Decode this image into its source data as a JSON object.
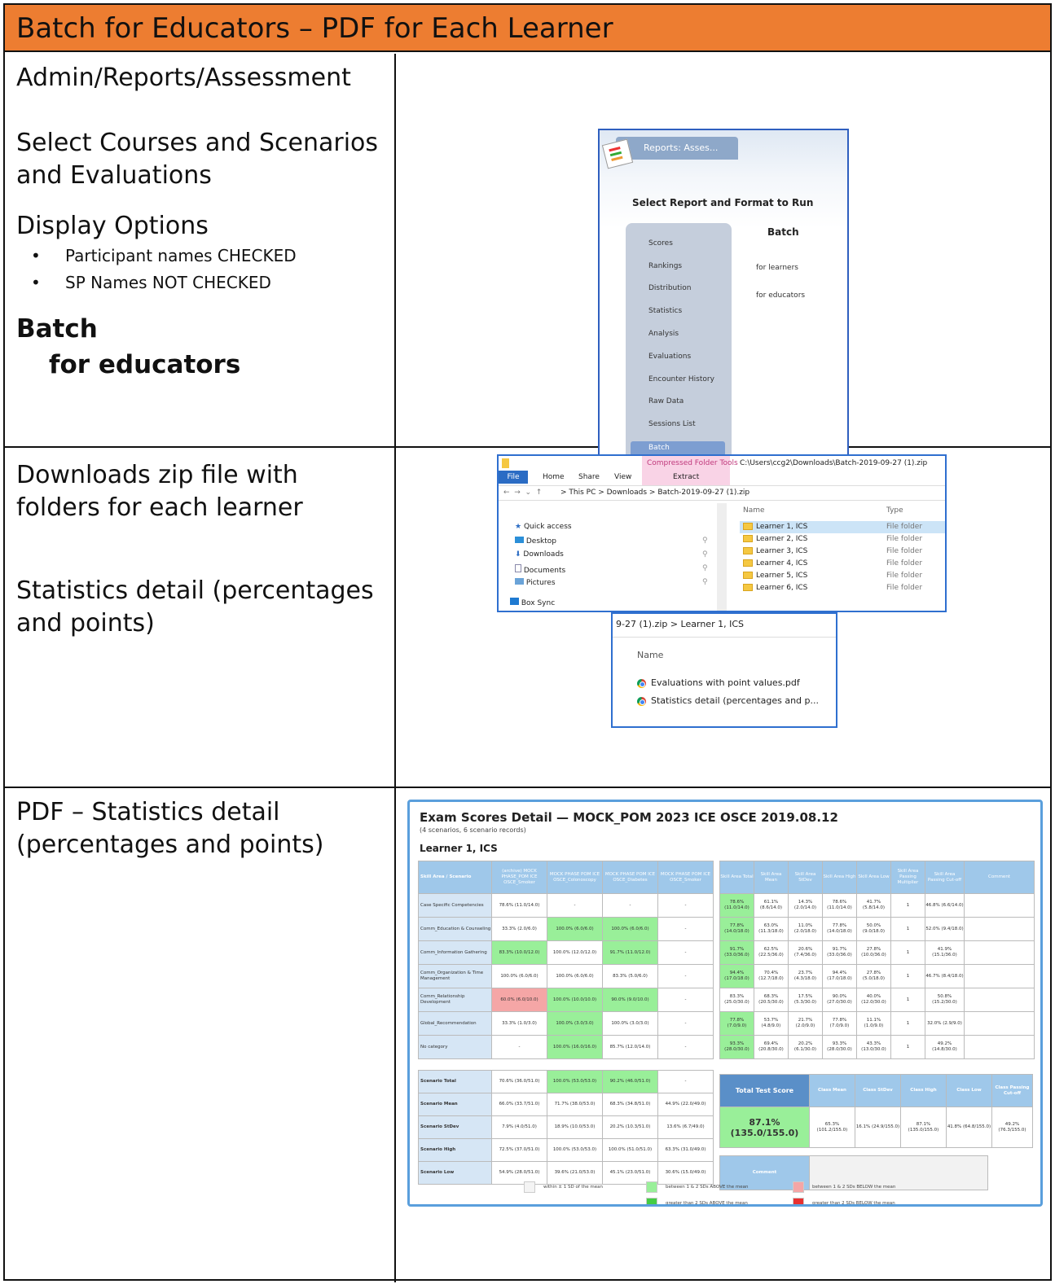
{
  "header": {
    "title": "Batch for Educators – PDF for Each Learner"
  },
  "row1": {
    "path": "Admin/Reports/Assessment",
    "select": "Select Courses and Scenarios and Evaluations",
    "display_options": "Display Options",
    "bullets": [
      "Participant names CHECKED",
      "SP Names NOT CHECKED"
    ],
    "batch": "Batch",
    "for_educators": "for educators",
    "app": {
      "tab": "Reports:  Asses...",
      "heading": "Select Report and Format to Run",
      "nav": [
        "Scores",
        "Rankings",
        "Distribution",
        "Statistics",
        "Analysis",
        "Evaluations",
        "Encounter History",
        "Raw Data",
        "Sessions List",
        "Batch"
      ],
      "batch_title": "Batch",
      "batch_options": [
        "for learners",
        "for educators"
      ]
    }
  },
  "row2": {
    "text1": "Downloads zip file with folders for each learner",
    "text2": "Statistics detail (percentages and points)",
    "explorer": {
      "ribbon_tools": "Compressed Folder Tools",
      "path_title": "C:\\Users\\ccg2\\Downloads\\Batch-2019-09-27 (1).zip",
      "tabs": [
        "File",
        "Home",
        "Share",
        "View"
      ],
      "extract": "Extract",
      "address": "> This PC > Downloads > Batch-2019-09-27 (1).zip",
      "nav": [
        "Quick access",
        "Desktop",
        "Downloads",
        "Documents",
        "Pictures",
        "Box Sync"
      ],
      "col_name": "Name",
      "col_type": "Type",
      "files": [
        {
          "name": "Learner 1, ICS",
          "type": "File folder"
        },
        {
          "name": "Learner 2, ICS",
          "type": "File folder"
        },
        {
          "name": "Learner 3, ICS",
          "type": "File folder"
        },
        {
          "name": "Learner 4, ICS",
          "type": "File folder"
        },
        {
          "name": "Learner 5, ICS",
          "type": "File folder"
        },
        {
          "name": "Learner 6, ICS",
          "type": "File folder"
        }
      ]
    },
    "explorer2": {
      "address": "9-27 (1).zip  >  Learner 1, ICS",
      "col_name": "Name",
      "files": [
        "Evaluations with point values.pdf",
        "Statistics detail (percentages and p..."
      ]
    }
  },
  "row3": {
    "text": "PDF – Statistics detail (percentages and points)",
    "report": {
      "title": "Exam Scores Detail — MOCK_POM 2023 ICE OSCE 2019.08.12",
      "subtitle": "(4 scenarios, 6 scenario records)",
      "learner": "Learner 1, ICS",
      "left_headers": [
        "Skill Area / Scenario",
        "(archive) MOCK PHASE_POM ICE OSCE_Smoker",
        "MOCK PHASE POM ICE OSCE_Colonoscopy",
        "MOCK PHASE POM ICE OSCE_Diabetes",
        "MOCK PHASE POM ICE OSCE_Smoker"
      ],
      "right_headers": [
        "Skill Area Total",
        "Skill Area Mean",
        "Skill Area StDev",
        "Skill Area High",
        "Skill Area Low",
        "Skill Area Passing Multiplier",
        "Skill Area Passing Cut-off",
        "Comment"
      ],
      "skill_rows": [
        {
          "label": "Case Specific Competencies",
          "cells": [
            "78.6% (11.0/14.0)",
            "-",
            "-",
            "-"
          ],
          "right": [
            "78.6% (11.0/14.0)",
            "61.1% (8.6/14.0)",
            "14.3% (2.0/14.0)",
            "78.6% (11.0/14.0)",
            "41.7% (5.8/14.0)",
            "1",
            "46.8% (6.6/14.0)",
            ""
          ]
        },
        {
          "label": "Comm_Education & Counseling",
          "cells": [
            "33.3% (2.0/6.0)",
            "100.0% (6.0/6.0)",
            "100.0% (6.0/6.0)",
            "-"
          ],
          "right": [
            "77.8% (14.0/18.0)",
            "63.0% (11.3/18.0)",
            "11.0% (2.0/18.0)",
            "77.8% (14.0/18.0)",
            "50.0% (9.0/18.0)",
            "1",
            "52.0% (9.4/18.0)",
            ""
          ]
        },
        {
          "label": "Comm_Information Gathering",
          "cells": [
            "83.3% (10.0/12.0)",
            "100.0% (12.0/12.0)",
            "91.7% (11.0/12.0)",
            "-"
          ],
          "right": [
            "91.7% (33.0/36.0)",
            "62.5% (22.5/36.0)",
            "20.6% (7.4/36.0)",
            "91.7% (33.0/36.0)",
            "27.8% (10.0/36.0)",
            "1",
            "41.9% (15.1/36.0)",
            ""
          ]
        },
        {
          "label": "Comm_Organization & Time Management",
          "cells": [
            "100.0% (6.0/6.0)",
            "100.0% (6.0/6.0)",
            "83.3% (5.0/6.0)",
            "-"
          ],
          "right": [
            "94.4% (17.0/18.0)",
            "70.4% (12.7/18.0)",
            "23.7% (4.3/18.0)",
            "94.4% (17.0/18.0)",
            "27.8% (5.0/18.0)",
            "1",
            "46.7% (8.4/18.0)",
            ""
          ]
        },
        {
          "label": "Comm_Relationship Development",
          "cells": [
            "60.0% (6.0/10.0)",
            "100.0% (10.0/10.0)",
            "90.0% (9.0/10.0)",
            "-"
          ],
          "right": [
            "83.3% (25.0/30.0)",
            "68.3% (20.5/30.0)",
            "17.5% (5.3/30.0)",
            "90.0% (27.0/30.0)",
            "40.0% (12.0/30.0)",
            "1",
            "50.8% (15.2/30.0)",
            ""
          ]
        },
        {
          "label": "Global_Recommendation",
          "cells": [
            "33.3% (1.0/3.0)",
            "100.0% (3.0/3.0)",
            "100.0% (3.0/3.0)",
            "-"
          ],
          "right": [
            "77.8% (7.0/9.0)",
            "53.7% (4.8/9.0)",
            "21.7% (2.0/9.0)",
            "77.8% (7.0/9.0)",
            "11.1% (1.0/9.0)",
            "1",
            "32.0% (2.9/9.0)",
            ""
          ]
        },
        {
          "label": "No category",
          "cells": [
            "-",
            "100.0% (16.0/16.0)",
            "85.7% (12.0/14.0)",
            "-"
          ],
          "right": [
            "93.3% (28.0/30.0)",
            "69.4% (20.8/30.0)",
            "20.2% (6.1/30.0)",
            "93.3% (28.0/30.0)",
            "43.3% (13.0/30.0)",
            "1",
            "49.2% (14.8/30.0)",
            ""
          ]
        }
      ],
      "scenario_rows": [
        {
          "label": "Scenario Total",
          "cells": [
            "70.6% (36.0/51.0)",
            "100.0% (53.0/53.0)",
            "90.2% (46.0/51.0)",
            "-"
          ]
        },
        {
          "label": "Scenario Mean",
          "cells": [
            "66.0% (33.7/51.0)",
            "71.7% (38.0/53.0)",
            "68.3% (34.8/51.0)",
            "44.9% (22.0/49.0)"
          ]
        },
        {
          "label": "Scenario StDev",
          "cells": [
            "7.9% (4.0/51.0)",
            "18.9% (10.0/53.0)",
            "20.2% (10.3/51.0)",
            "13.6% (6.7/49.0)"
          ]
        },
        {
          "label": "Scenario High",
          "cells": [
            "72.5% (37.0/51.0)",
            "100.0% (53.0/53.0)",
            "100.0% (51.0/51.0)",
            "63.3% (31.0/49.0)"
          ]
        },
        {
          "label": "Scenario Low",
          "cells": [
            "54.9% (28.0/51.0)",
            "39.6% (21.0/53.0)",
            "45.1% (23.0/51.0)",
            "30.6% (15.0/49.0)"
          ]
        }
      ],
      "total_headers": [
        "Total Test Score",
        "Class Mean",
        "Class StDev",
        "Class High",
        "Class Low",
        "Class Passing Cut-off"
      ],
      "total_values": [
        "87.1% (135.0/155.0)",
        "65.3% (101.2/155.0)",
        "16.1% (24.9/155.0)",
        "87.1% (135.0/155.0)",
        "41.8% (64.8/155.0)",
        "49.2% (76.3/155.0)"
      ],
      "comment_label": "Comment",
      "legend": [
        "within ± 1 SD of the mean",
        "between 1 & 2 SDs ABOVE the mean",
        "between 1 & 2 SDs BELOW the mean",
        "greater than 2 SDs ABOVE the mean",
        "greater than 2 SDs BELOW the mean"
      ],
      "colors": {
        "header": "#9fc8ea",
        "label": "#d6e6f5",
        "green_light": "#99ef99",
        "green_dark": "#44cc44",
        "red_light": "#f5a6a6",
        "red_dark": "#e83030",
        "border": "#5a9fdc"
      }
    }
  }
}
